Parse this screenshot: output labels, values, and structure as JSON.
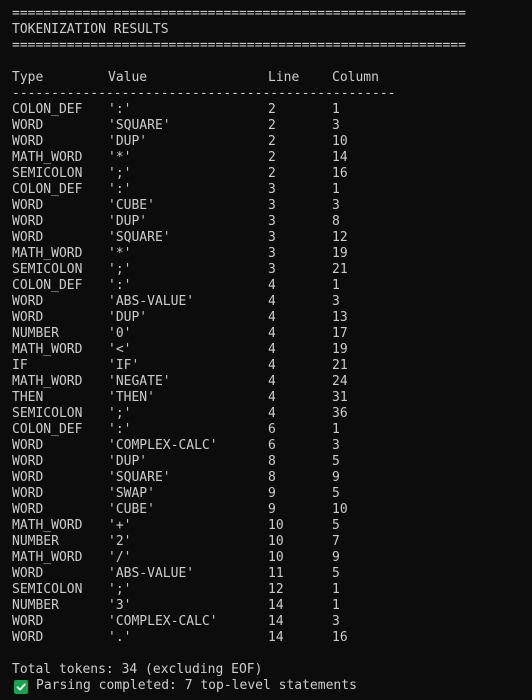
{
  "terminal": {
    "rule_top": "==========================================================",
    "title": "TOKENIZATION RESULTS",
    "rule_bottom": "==========================================================",
    "headers": [
      "Type",
      "Value",
      "Line",
      "Column"
    ],
    "header_rule": "-------------------------------------------------",
    "rows": [
      [
        "COLON_DEF",
        "':'",
        "2",
        "1"
      ],
      [
        "WORD",
        "'SQUARE'",
        "2",
        "3"
      ],
      [
        "WORD",
        "'DUP'",
        "2",
        "10"
      ],
      [
        "MATH_WORD",
        "'*'",
        "2",
        "14"
      ],
      [
        "SEMICOLON",
        "';'",
        "2",
        "16"
      ],
      [
        "COLON_DEF",
        "':'",
        "3",
        "1"
      ],
      [
        "WORD",
        "'CUBE'",
        "3",
        "3"
      ],
      [
        "WORD",
        "'DUP'",
        "3",
        "8"
      ],
      [
        "WORD",
        "'SQUARE'",
        "3",
        "12"
      ],
      [
        "MATH_WORD",
        "'*'",
        "3",
        "19"
      ],
      [
        "SEMICOLON",
        "';'",
        "3",
        "21"
      ],
      [
        "COLON_DEF",
        "':'",
        "4",
        "1"
      ],
      [
        "WORD",
        "'ABS-VALUE'",
        "4",
        "3"
      ],
      [
        "WORD",
        "'DUP'",
        "4",
        "13"
      ],
      [
        "NUMBER",
        "'0'",
        "4",
        "17"
      ],
      [
        "MATH_WORD",
        "'<'",
        "4",
        "19"
      ],
      [
        "IF",
        "'IF'",
        "4",
        "21"
      ],
      [
        "MATH_WORD",
        "'NEGATE'",
        "4",
        "24"
      ],
      [
        "THEN",
        "'THEN'",
        "4",
        "31"
      ],
      [
        "SEMICOLON",
        "';'",
        "4",
        "36"
      ],
      [
        "COLON_DEF",
        "':'",
        "6",
        "1"
      ],
      [
        "WORD",
        "'COMPLEX-CALC'",
        "6",
        "3"
      ],
      [
        "WORD",
        "'DUP'",
        "8",
        "5"
      ],
      [
        "WORD",
        "'SQUARE'",
        "8",
        "9"
      ],
      [
        "WORD",
        "'SWAP'",
        "9",
        "5"
      ],
      [
        "WORD",
        "'CUBE'",
        "9",
        "10"
      ],
      [
        "MATH_WORD",
        "'+'",
        "10",
        "5"
      ],
      [
        "NUMBER",
        "'2'",
        "10",
        "7"
      ],
      [
        "MATH_WORD",
        "'/'",
        "10",
        "9"
      ],
      [
        "WORD",
        "'ABS-VALUE'",
        "11",
        "5"
      ],
      [
        "SEMICOLON",
        "';'",
        "12",
        "1"
      ],
      [
        "NUMBER",
        "'3'",
        "14",
        "1"
      ],
      [
        "WORD",
        "'COMPLEX-CALC'",
        "14",
        "3"
      ],
      [
        "WORD",
        "'.'",
        "14",
        "16"
      ]
    ],
    "total_line": "Total tokens: 34 (excluding EOF)",
    "status_line": "Parsing completed: 7 top-level statements",
    "status_icon": "check-mark-icon",
    "status_icon_color": "#16a34a",
    "background_color": "#0c0c0c",
    "text_color": "#cccccc"
  }
}
